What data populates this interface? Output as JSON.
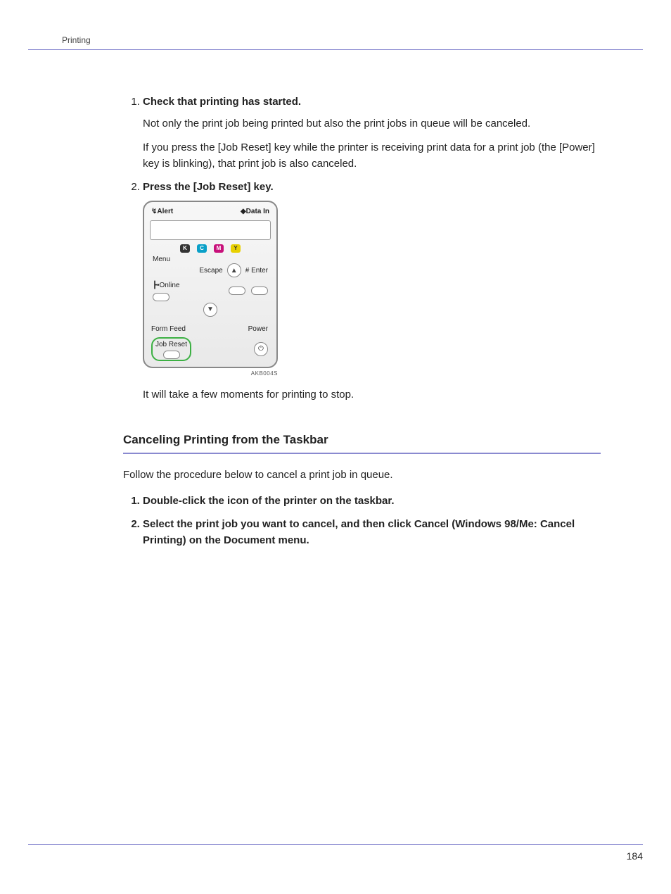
{
  "header": {
    "section": "Printing"
  },
  "steps": [
    {
      "title": "Check that printing has started.",
      "paragraphs": [
        "Not only the print job being printed but also the print jobs in queue will be canceled.",
        "If you press the [Job Reset] key while the printer is receiving print data for a print job (the [Power] key is blinking), that print job is also canceled."
      ]
    },
    {
      "title": "Press the [Job Reset] key.",
      "after_image_text": "It will take a few moments for printing to stop."
    }
  ],
  "panel": {
    "alert": "Alert",
    "data_in": "Data In",
    "toners": {
      "K": "K",
      "C": "C",
      "M": "M",
      "Y": "Y"
    },
    "menu": "Menu",
    "escape": "Escape",
    "enter": "# Enter",
    "online": "Online",
    "form_feed": "Form Feed",
    "power": "Power",
    "job_reset": "Job Reset",
    "code": "AKB004S"
  },
  "section2": {
    "heading": "Canceling Printing from the Taskbar",
    "intro": "Follow the procedure below to cancel a print job in queue.",
    "steps": [
      "Double-click the icon of the printer on the taskbar.",
      "Select the print job you want to cancel, and then click Cancel (Windows 98/Me: Cancel Printing) on the Document menu."
    ]
  },
  "footer": {
    "page": "184"
  }
}
